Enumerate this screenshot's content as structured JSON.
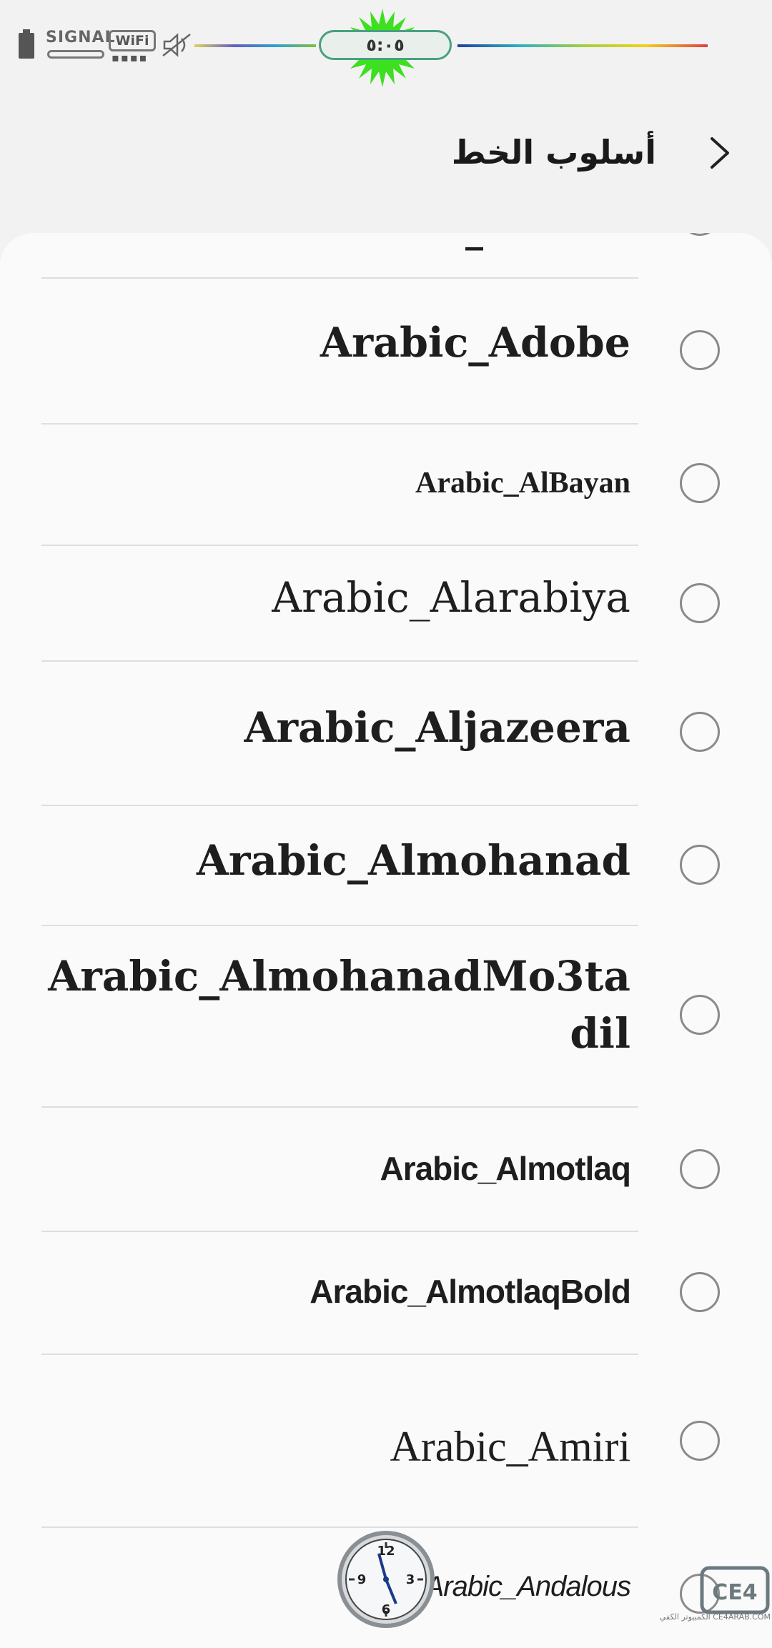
{
  "status_bar": {
    "signal_label": "SIGNAL",
    "wifi_label": "WiFi",
    "clock": "٥:٠٥",
    "wifi_dots": "▪▪▪▪"
  },
  "header": {
    "title": "أسلوب الخط",
    "back_icon": "chevron-back-icon"
  },
  "fonts": [
    {
      "label": "Arabic_Adobe",
      "selected": false
    },
    {
      "label": "Arabic_AlBayan",
      "selected": false
    },
    {
      "label": "Arabic_Alarabiya",
      "selected": false
    },
    {
      "label": "Arabic_Aljazeera",
      "selected": false
    },
    {
      "label": "Arabic_Almohanad",
      "selected": false
    },
    {
      "label_line1": "Arabic_AlmohanadMo3ta",
      "label_line2": "dil",
      "selected": false
    },
    {
      "label": "Arabic_Almotlaq",
      "selected": false
    },
    {
      "label": "Arabic_AlmotlaqBold",
      "selected": false
    },
    {
      "label": "Arabic_Amiri",
      "selected": false
    },
    {
      "label": "Arabic_Andalous",
      "selected": false
    }
  ],
  "partial_top_item": {
    "label": "_"
  },
  "watermark": {
    "caption": "الكمبيوتر الكفي CE4ARAB.COM",
    "logo_letters": "CE4"
  },
  "watch": {
    "numbers": [
      "12",
      "3",
      "6",
      "9"
    ]
  }
}
